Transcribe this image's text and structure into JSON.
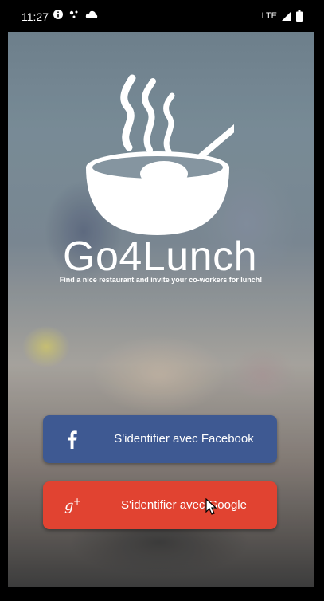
{
  "status_bar": {
    "time": "11:27",
    "network": "LTE",
    "icons": [
      "info-icon",
      "dots-icon",
      "cloud-icon",
      "signal-icon",
      "battery-icon"
    ]
  },
  "app": {
    "title": "Go4Lunch",
    "tagline": "Find a nice restaurant and invite your co-workers for lunch!",
    "logo": "bowl-icon"
  },
  "buttons": {
    "facebook": {
      "label": "S'identifier avec Facebook",
      "icon": "facebook-icon",
      "color": "#3b5998"
    },
    "google": {
      "label": "S'identifier avec Google",
      "icon": "google-plus-icon",
      "color": "#ef3f2b"
    }
  }
}
